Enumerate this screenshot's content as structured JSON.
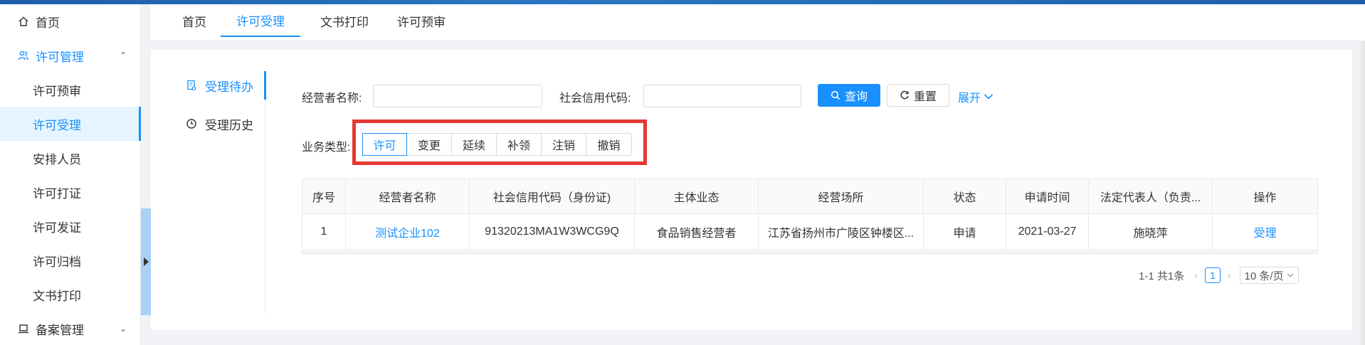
{
  "sidebar": {
    "items": [
      {
        "label": "首页",
        "icon": "home-icon"
      },
      {
        "label": "许可管理",
        "icon": "people-icon"
      },
      {
        "label": "许可预审"
      },
      {
        "label": "许可受理"
      },
      {
        "label": "安排人员"
      },
      {
        "label": "许可打证"
      },
      {
        "label": "许可发证"
      },
      {
        "label": "许可归档"
      },
      {
        "label": "文书打印"
      },
      {
        "label": "备案管理",
        "icon": "laptop-icon"
      }
    ]
  },
  "tabs": [
    {
      "label": "首页"
    },
    {
      "label": "许可受理"
    },
    {
      "label": "文书打印"
    },
    {
      "label": "许可预审"
    }
  ],
  "vtabs": [
    {
      "label": "受理待办",
      "icon": "document-icon"
    },
    {
      "label": "受理历史",
      "icon": "clock-icon"
    }
  ],
  "search": {
    "operator_label": "经营者名称:",
    "operator_value": "",
    "credit_label": "社会信用代码:",
    "credit_value": "",
    "query_label": "查询",
    "reset_label": "重置",
    "expand_label": "展开"
  },
  "biz_type": {
    "label": "业务类型:",
    "options": [
      "许可",
      "变更",
      "延续",
      "补领",
      "注销",
      "撤销"
    ],
    "selected": "许可"
  },
  "table": {
    "headers": [
      "序号",
      "经营者名称",
      "社会信用代码（身份证)",
      "主体业态",
      "经营场所",
      "状态",
      "申请时间",
      "法定代表人（负责...",
      "操作"
    ],
    "rows": [
      [
        "1",
        "测试企业102",
        "91320213MA1W3WCG9Q",
        "食品销售经营者",
        "江苏省扬州市广陵区钟楼区...",
        "申请",
        "2021-03-27",
        "施晓萍",
        "受理"
      ]
    ]
  },
  "pagination": {
    "summary": "1-1 共1条",
    "current": "1",
    "page_size": "10 条/页"
  },
  "colors": {
    "accent": "#1890ff",
    "highlight": "#e53935"
  }
}
